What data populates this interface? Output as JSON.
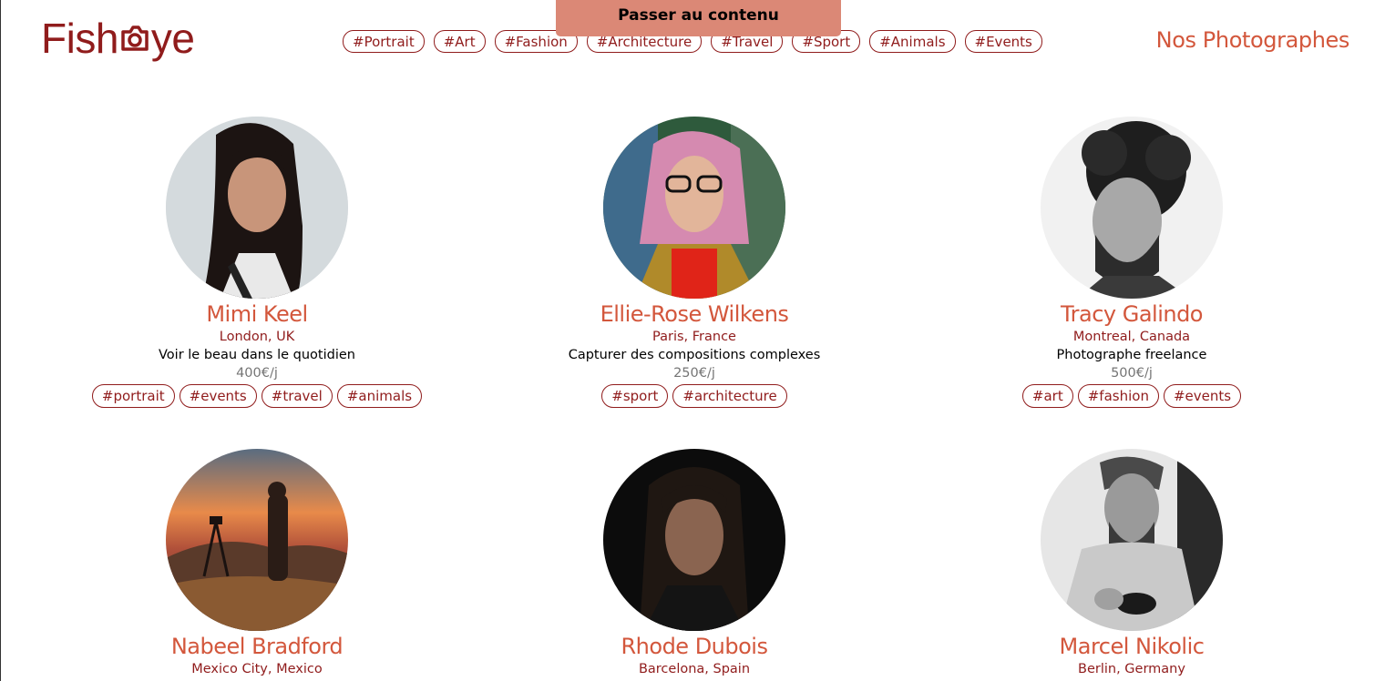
{
  "skip_link": "Passer au contenu",
  "logo": {
    "text_before": "Fish",
    "text_after": "ye",
    "icon": "camera-icon",
    "color": "#901c1c"
  },
  "nav_tags": [
    "#Portrait",
    "#Art",
    "#Fashion",
    "#Architecture",
    "#Travel",
    "#Sport",
    "#Animals",
    "#Events"
  ],
  "page_title": "Nos Photographes",
  "colors": {
    "primary": "#901c1c",
    "secondary": "#d3573c",
    "skip_bg": "#db8876",
    "muted": "#757575"
  },
  "photographers": [
    {
      "name": "Mimi Keel",
      "location": "London, UK",
      "tagline": "Voir le beau dans le quotidien",
      "price": "400€/j",
      "tags": [
        "#portrait",
        "#events",
        "#travel",
        "#animals"
      ]
    },
    {
      "name": "Ellie-Rose Wilkens",
      "location": "Paris, France",
      "tagline": "Capturer des compositions complexes",
      "price": "250€/j",
      "tags": [
        "#sport",
        "#architecture"
      ]
    },
    {
      "name": "Tracy Galindo",
      "location": "Montreal, Canada",
      "tagline": "Photographe freelance",
      "price": "500€/j",
      "tags": [
        "#art",
        "#fashion",
        "#events"
      ]
    },
    {
      "name": "Nabeel Bradford",
      "location": "Mexico City, Mexico",
      "tagline": "",
      "price": "",
      "tags": []
    },
    {
      "name": "Rhode Dubois",
      "location": "Barcelona, Spain",
      "tagline": "",
      "price": "",
      "tags": []
    },
    {
      "name": "Marcel Nikolic",
      "location": "Berlin, Germany",
      "tagline": "",
      "price": "",
      "tags": []
    }
  ]
}
